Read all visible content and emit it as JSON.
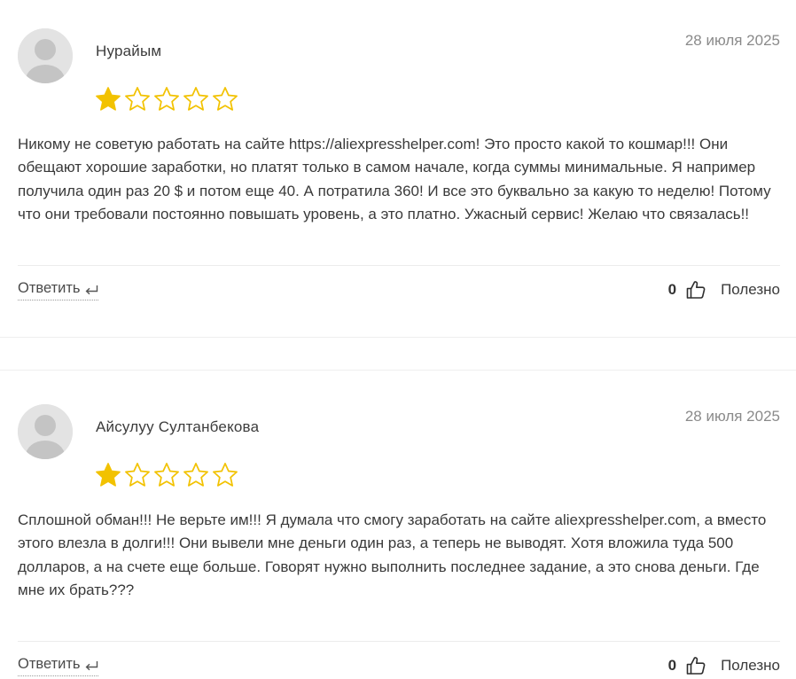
{
  "reviews": [
    {
      "author": "Нурайым",
      "date": "28 июля 2025",
      "rating": 1,
      "max_rating": 5,
      "text": "Никому не советую работать на сайте https://aliexpresshelper.com! Это просто какой то кошмар!!! Они обещают хорошие заработки, но платят только в самом начале, когда суммы минимальные. Я например получила один раз 20 $ и потом еще 40. А потратила 360! И все это буквально за какую то неделю! Потому что они требовали постоянно повышать уровень, а это платно. Ужасный сервис! Желаю что связалась!!",
      "reply_label": "Ответить",
      "helpful_count": "0",
      "helpful_label": "Полезно"
    },
    {
      "author": "Айсулуу Султанбекова",
      "date": "28 июля 2025",
      "rating": 1,
      "max_rating": 5,
      "text": "Сплошной обман!!! Не верьте им!!! Я думала что смогу заработать на сайте aliexpresshelper.com, а вместо этого влезла в долги!!! Они вывели мне деньги один раз, а теперь не выводят. Хотя вложила туда 500 долларов, а на счете еще больше. Говорят нужно выполнить последнее задание, а это снова деньги. Где мне их брать???",
      "reply_label": "Ответить",
      "helpful_count": "0",
      "helpful_label": "Полезно"
    }
  ],
  "colors": {
    "star_filled": "#f2c200",
    "star_empty_stroke": "#f2c200",
    "avatar_bg": "#e3e3e3",
    "avatar_fg": "#c4c4c4",
    "date": "#8a8a8a",
    "divider": "#ececec"
  },
  "icons": {
    "avatar": "default-user-avatar-icon",
    "star": "star-icon",
    "reply": "reply-arrow-icon",
    "helpful": "thumbs-up-icon"
  }
}
